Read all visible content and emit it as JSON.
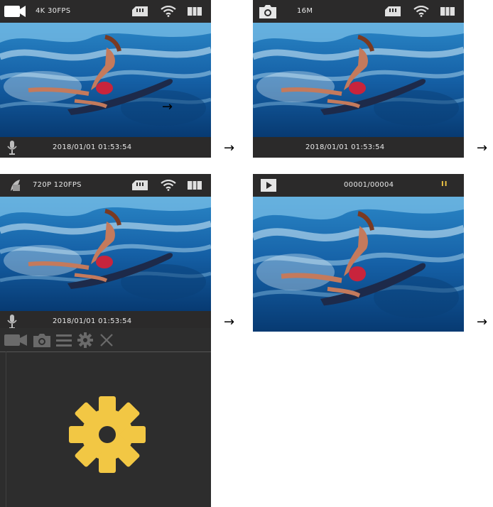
{
  "screens": {
    "video": {
      "mode_label": "4K 30FPS",
      "timestamp": "2018/01/01  01:53:54"
    },
    "photo": {
      "mode_label": "16M",
      "timestamp": "2018/01/01  01:53:54"
    },
    "slowmo": {
      "mode_label": "720P 120FPS",
      "timestamp": "2018/01/01  01:53:54"
    },
    "playback": {
      "counter": "00001/00004",
      "pause_icon": "II"
    }
  },
  "arrow": "→",
  "menu": {
    "icons": [
      "video-camera-icon",
      "camera-icon",
      "list-icon",
      "gear-icon",
      "close-icon"
    ],
    "selected": "gear-icon"
  },
  "colors": {
    "bar": "#2b2a2a",
    "accent": "#f2c744",
    "text": "#e9e9e9"
  }
}
